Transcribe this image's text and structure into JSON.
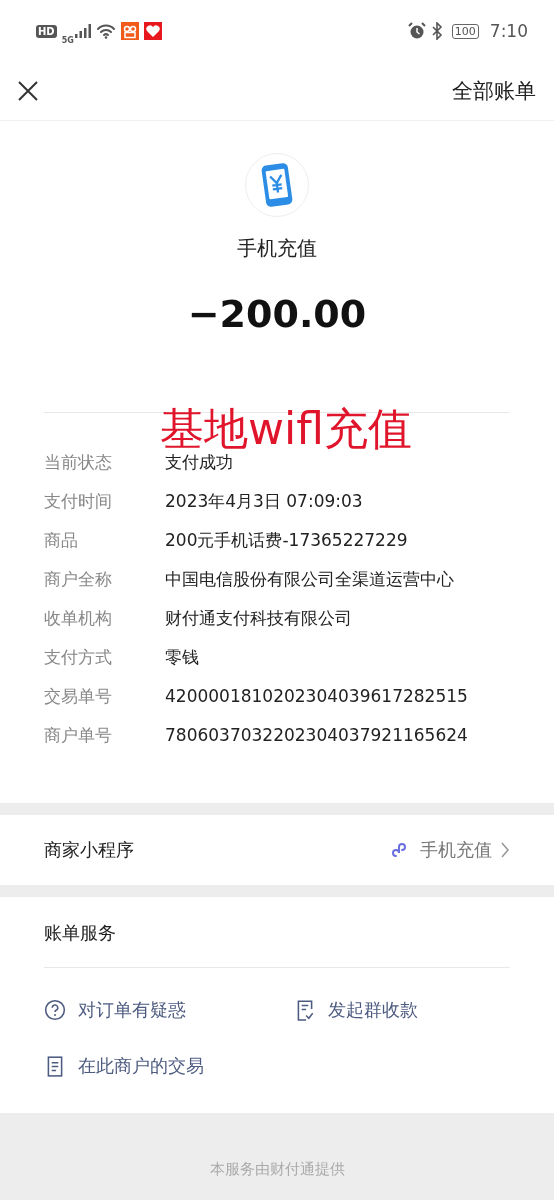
{
  "status_bar": {
    "network_badge": "HD",
    "network_type": "5G",
    "battery": "100",
    "time": "7:10"
  },
  "header": {
    "action": "全部账单"
  },
  "summary": {
    "title": "手机充值",
    "amount": "−200.00"
  },
  "annotation": "基地wifl充值",
  "details": [
    {
      "label": "当前状态",
      "value": "支付成功"
    },
    {
      "label": "支付时间",
      "value": "2023年4月3日 07:09:03"
    },
    {
      "label": "商品",
      "value": "200元手机话费-17365227229"
    },
    {
      "label": "商户全称",
      "value": "中国电信股份有限公司全渠道运营中心"
    },
    {
      "label": "收单机构",
      "value": "财付通支付科技有限公司"
    },
    {
      "label": "支付方式",
      "value": "零钱"
    },
    {
      "label": "交易单号",
      "value": "4200001810202304039617282515"
    },
    {
      "label": "商户单号",
      "value": "7806037032202304037921165624"
    }
  ],
  "mini_program": {
    "label": "商家小程序",
    "value": "手机充值"
  },
  "services": {
    "title": "账单服务",
    "items": [
      {
        "kind": "question",
        "label": "对订单有疑惑"
      },
      {
        "kind": "split",
        "label": "发起群收款"
      },
      {
        "kind": "list",
        "label": "在此商户的交易"
      }
    ]
  },
  "footer": "本服务由财付通提供"
}
